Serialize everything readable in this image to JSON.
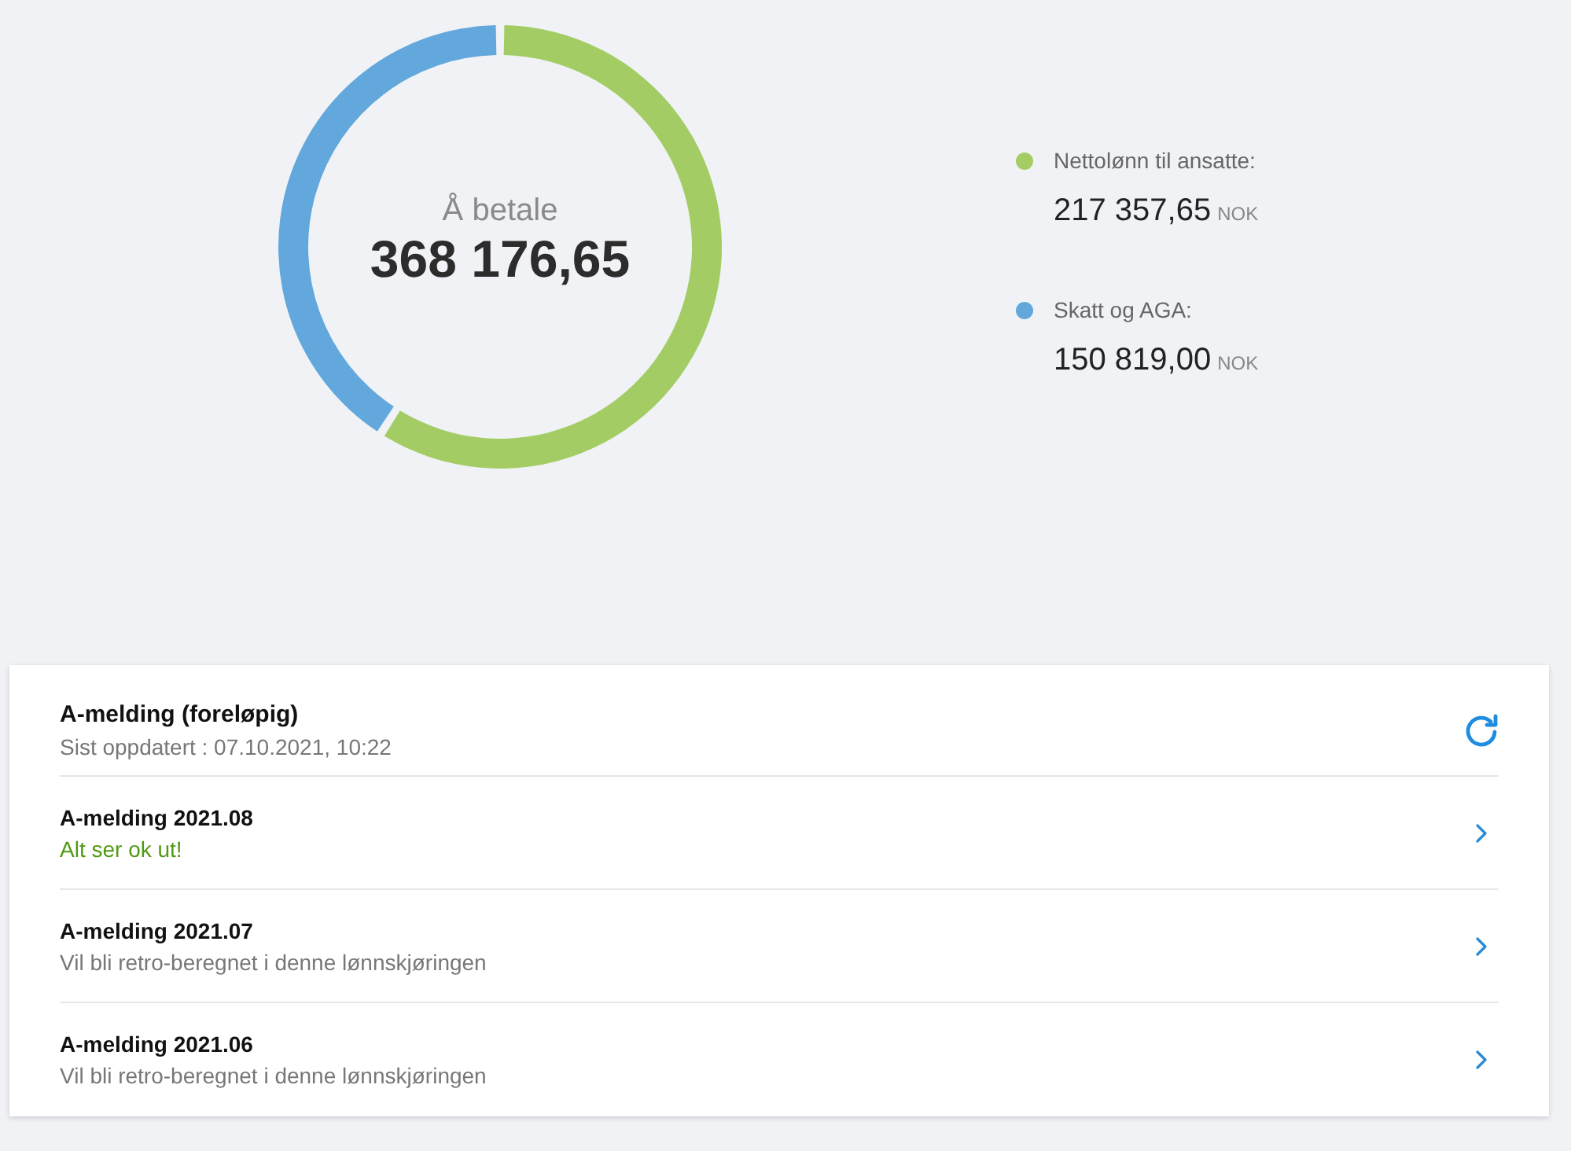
{
  "summary": {
    "label": "Å betale",
    "total": "368 176,65",
    "chart_data": {
      "type": "donut",
      "values": [
        59.04,
        40.96
      ]
    }
  },
  "legend": [
    {
      "label": "Nettolønn til ansatte:",
      "amount": "217 357,65",
      "currency": "NOK",
      "color": "#a3cd64"
    },
    {
      "label": "Skatt og AGA:",
      "amount": "150 819,00",
      "currency": "NOK",
      "color": "#62a8dc"
    }
  ],
  "a_melding": {
    "title": "A-melding (foreløpig)",
    "updated": "Sist oppdatert : 07.10.2021, 10:22",
    "items": [
      {
        "title": "A-melding 2021.08",
        "message": "Alt ser ok ut!",
        "kind": "ok"
      },
      {
        "title": "A-melding 2021.07",
        "message": "Vil bli retro-beregnet i denne lønnskjøringen",
        "kind": "notice"
      },
      {
        "title": "A-melding 2021.06",
        "message": "Vil bli retro-beregnet i denne lønnskjøringen",
        "kind": "notice"
      }
    ]
  }
}
